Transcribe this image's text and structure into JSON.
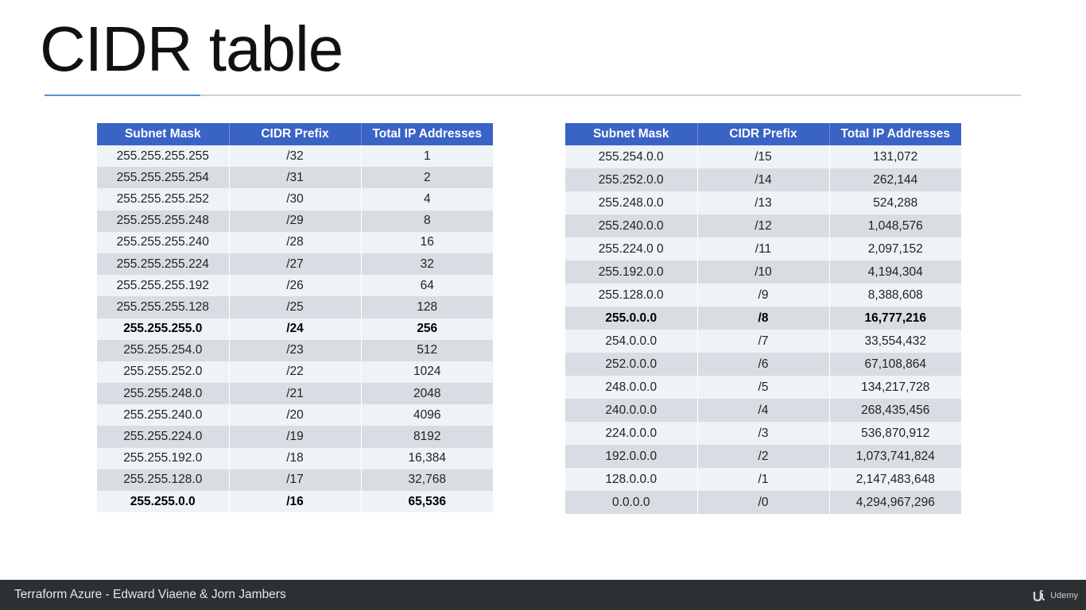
{
  "slide": {
    "title": "CIDR table"
  },
  "table_left": {
    "headers": [
      "Subnet Mask",
      "CIDR Prefix",
      "Total IP Addresses"
    ],
    "rows": [
      [
        "255.255.255.255",
        "/32",
        "1"
      ],
      [
        "255.255.255.254",
        "/31",
        "2"
      ],
      [
        "255.255.255.252",
        "/30",
        "4"
      ],
      [
        "255.255.255.248",
        "/29",
        "8"
      ],
      [
        "255.255.255.240",
        "/28",
        "16"
      ],
      [
        "255.255.255.224",
        "/27",
        "32"
      ],
      [
        "255.255.255.192",
        "/26",
        "64"
      ],
      [
        "255.255.255.128",
        "/25",
        "128"
      ],
      [
        "255.255.255.0",
        "/24",
        "256"
      ],
      [
        "255.255.254.0",
        "/23",
        "512"
      ],
      [
        "255.255.252.0",
        "/22",
        "1024"
      ],
      [
        "255.255.248.0",
        "/21",
        "2048"
      ],
      [
        "255.255.240.0",
        "/20",
        "4096"
      ],
      [
        "255.255.224.0",
        "/19",
        "8192"
      ],
      [
        "255.255.192.0",
        "/18",
        "16,384"
      ],
      [
        "255.255.128.0",
        "/17",
        "32,768"
      ],
      [
        "255.255.0.0",
        "/16",
        "65,536"
      ]
    ]
  },
  "table_right": {
    "headers": [
      "Subnet Mask",
      "CIDR Prefix",
      "Total IP Addresses"
    ],
    "rows": [
      [
        "255.254.0.0",
        "/15",
        "131,072"
      ],
      [
        "255.252.0.0",
        "/14",
        "262,144"
      ],
      [
        "255.248.0.0",
        "/13",
        "524,288"
      ],
      [
        "255.240.0.0",
        "/12",
        "1,048,576"
      ],
      [
        "255.224.0 0",
        "/11",
        "2,097,152"
      ],
      [
        "255.192.0.0",
        "/10",
        "4,194,304"
      ],
      [
        "255.128.0.0",
        "/9",
        "8,388,608"
      ],
      [
        "255.0.0.0",
        "/8",
        "16,777,216"
      ],
      [
        "254.0.0.0",
        "/7",
        "33,554,432"
      ],
      [
        "252.0.0.0",
        "/6",
        "67,108,864"
      ],
      [
        "248.0.0.0",
        "/5",
        "134,217,728"
      ],
      [
        "240.0.0.0",
        "/4",
        "268,435,456"
      ],
      [
        "224.0.0.0",
        "/3",
        "536,870,912"
      ],
      [
        "192.0.0.0",
        "/2",
        "1,073,741,824"
      ],
      [
        "128.0.0.0",
        "/1",
        "2,147,483,648"
      ],
      [
        "0.0.0.0",
        "/0",
        "4,294,967,296"
      ]
    ]
  },
  "footer": {
    "text": "Terraform Azure - Edward Viaene & Jorn Jambers",
    "logo_text": "Udemy",
    "logo_icon": "udemy-logo-icon"
  },
  "colors": {
    "header_bg": "#3a63c6",
    "row_light": "#eef3f6",
    "row_dark": "#d8dde3",
    "footer_bg": "#2b3033",
    "title_accent": "#5b8fce"
  }
}
